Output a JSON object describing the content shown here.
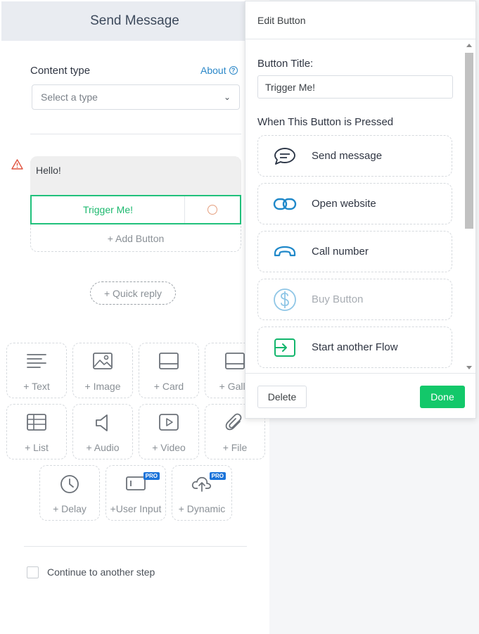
{
  "left_panel": {
    "title": "Send Message",
    "content_type_label": "Content type",
    "about_label": "About",
    "select_placeholder": "Select a type",
    "message_text": "Hello!",
    "button_title": "Trigger Me!",
    "add_button_label": "+ Add Button",
    "quick_reply_label": "+ Quick reply",
    "tiles": [
      {
        "label": "+ Text",
        "icon": "text-lines-icon"
      },
      {
        "label": "+ Image",
        "icon": "image-icon"
      },
      {
        "label": "+ Card",
        "icon": "card-icon"
      },
      {
        "label": "+ Galle",
        "icon": "gallery-icon"
      },
      {
        "label": "+ List",
        "icon": "list-icon"
      },
      {
        "label": "+ Audio",
        "icon": "speaker-icon"
      },
      {
        "label": "+ Video",
        "icon": "video-play-icon"
      },
      {
        "label": "+ File",
        "icon": "paperclip-icon"
      },
      {
        "label": "+ Delay",
        "icon": "clock-icon"
      },
      {
        "label": "+User Input",
        "icon": "input-field-icon",
        "badge": "PRO"
      },
      {
        "label": "+ Dynamic",
        "icon": "cloud-upload-icon",
        "badge": "PRO"
      }
    ],
    "continue_label": "Continue to another step"
  },
  "popup": {
    "title": "Edit Button",
    "button_title_label": "Button Title:",
    "button_title_value": "Trigger Me!",
    "pressed_label": "When This Button is Pressed",
    "actions": [
      {
        "label": "Send message",
        "icon": "chat-bubble-icon",
        "color": "#2d3748"
      },
      {
        "label": "Open website",
        "icon": "link-icon",
        "color": "#1f88c9"
      },
      {
        "label": "Call number",
        "icon": "phone-icon",
        "color": "#1f88c9"
      },
      {
        "label": "Buy Button",
        "icon": "dollar-icon",
        "color": "#8fc6e6",
        "disabled": true
      },
      {
        "label": "Start another Flow",
        "icon": "flow-enter-icon",
        "color": "#13b66d"
      }
    ],
    "delete_label": "Delete",
    "done_label": "Done"
  },
  "colors": {
    "accent_green": "#13c86a",
    "link_blue": "#2a87c8",
    "warning_red": "#e0533f",
    "pro_badge": "#1a73d9"
  }
}
